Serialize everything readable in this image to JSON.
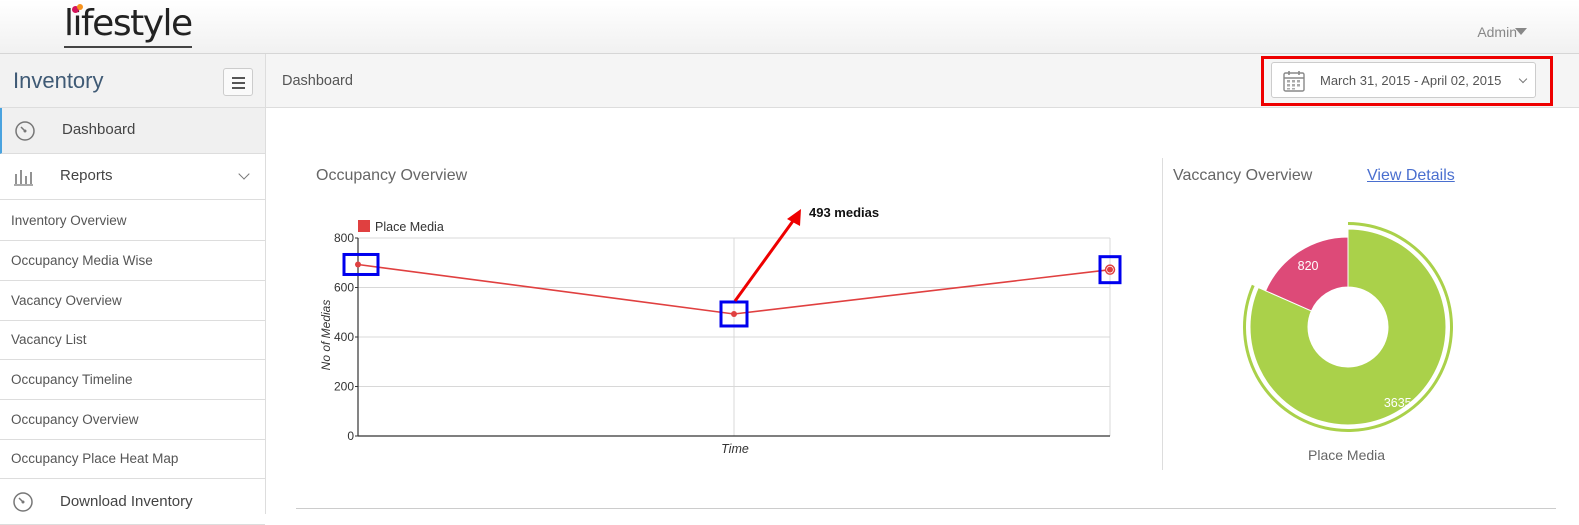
{
  "header": {
    "brand": "lifestyle",
    "user_menu": "Admin",
    "user_caret_icon": "caret-down-icon"
  },
  "sidebar": {
    "title": "Inventory",
    "menu_icon": "hamburger-icon",
    "items": [
      {
        "label": "Dashboard",
        "icon": "dashboard-gauge-icon",
        "active": true
      },
      {
        "label": "Reports",
        "icon": "bar-chart-icon",
        "expanded": true
      },
      {
        "label": "Inventory Overview"
      },
      {
        "label": "Occupancy Media Wise"
      },
      {
        "label": "Vacancy Overview"
      },
      {
        "label": "Vacancy List"
      },
      {
        "label": "Occupancy Timeline"
      },
      {
        "label": "Occupancy Overview"
      },
      {
        "label": "Occupancy Place Heat Map"
      },
      {
        "label": "Download Inventory",
        "icon": "dashboard-gauge-icon"
      }
    ]
  },
  "breadcrumb": {
    "current": "Dashboard"
  },
  "date_range": {
    "value": "March 31, 2015 - April 02, 2015",
    "icon": "calendar-icon"
  },
  "occupancy": {
    "title": "Occupancy Overview",
    "annotation": "493 medias",
    "colors": {
      "series": "#e04040",
      "annotation_arrow": "#ee0000",
      "marker_box": "#0000ee"
    }
  },
  "vacancy": {
    "title": "Vaccancy Overview",
    "link": "View Details",
    "caption": "Place Media",
    "colors": {
      "vacant": "#aad14a",
      "occupied": "#dd4a78"
    }
  },
  "chart_data": [
    {
      "type": "line",
      "legend": [
        "Place Media"
      ],
      "xlabel": "Time",
      "ylabel": "No of Medias",
      "ylim": [
        0,
        800
      ],
      "yticks": [
        0,
        200,
        400,
        600,
        800
      ],
      "grid": true,
      "legend_placement": "top-left",
      "series": [
        {
          "name": "Place Media",
          "values": [
            693,
            493,
            672
          ]
        }
      ]
    },
    {
      "type": "pie",
      "labels": [
        "820",
        "3635"
      ],
      "values": [
        820,
        3635
      ],
      "caption": "Place Media"
    }
  ]
}
